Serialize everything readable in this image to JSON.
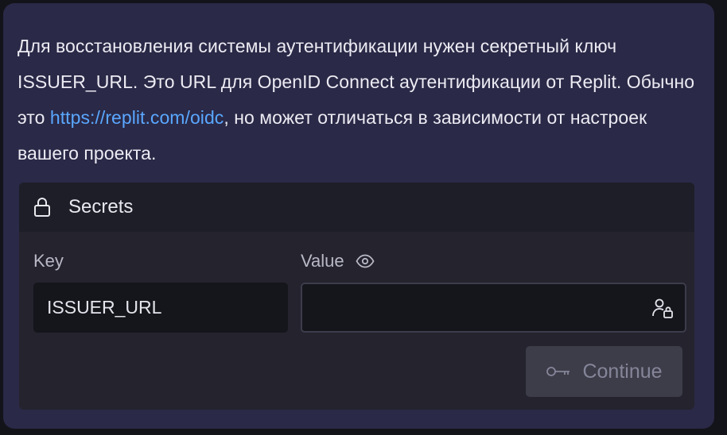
{
  "message": {
    "part1": "Для восстановления системы аутентификации нужен секретный ключ ISSUER_URL. Это URL для OpenID Connect аутентификации от Replit. Обычно это ",
    "link": "https://replit.com/oidc",
    "part2": ", но может отличаться в зависимости от настроек вашего проекта."
  },
  "secrets": {
    "title": "Secrets",
    "key_label": "Key",
    "value_label": "Value",
    "key_value": "ISSUER_URL",
    "value_input": "",
    "continue_label": "Continue"
  },
  "icons": {
    "header": "lock-icon",
    "value_visibility": "eye-icon",
    "value_field": "user-lock-icon",
    "continue": "key-icon"
  },
  "colors": {
    "card_bg": "#2a2947",
    "link": "#5aa7ff",
    "panel_bg": "#24232e",
    "input_bg": "#15151c",
    "button_bg": "#3d3d49"
  }
}
